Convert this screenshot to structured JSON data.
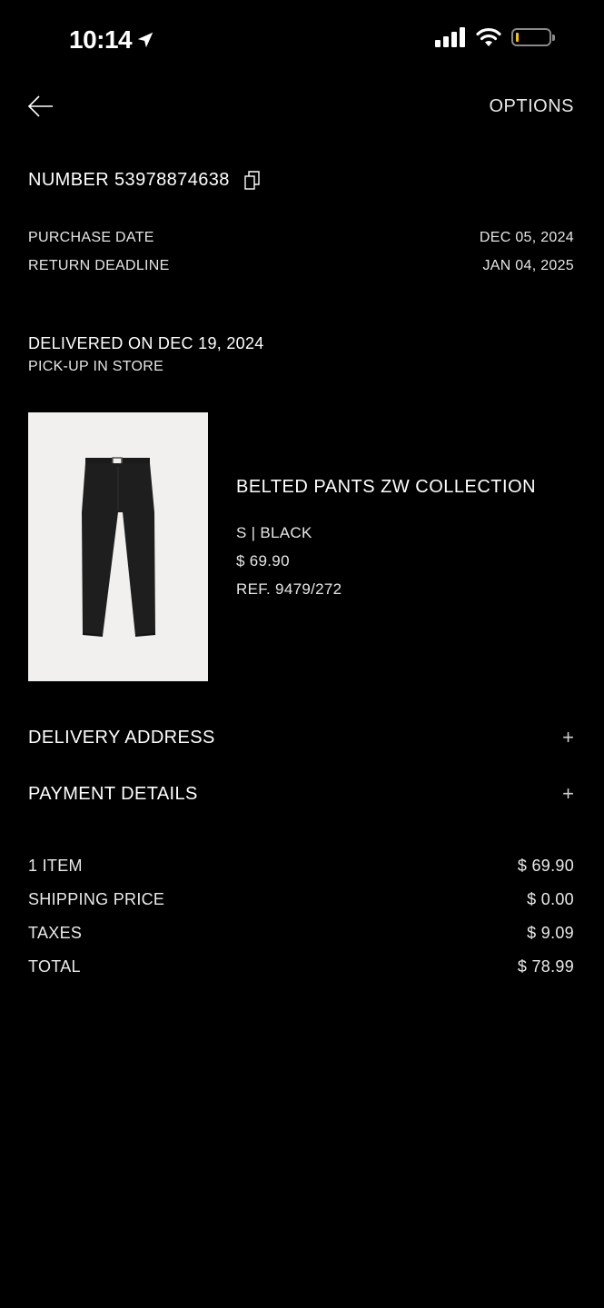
{
  "status_bar": {
    "time": "10:14",
    "icons": [
      "location-arrow-icon",
      "cellular-signal-icon",
      "wifi-icon",
      "battery-icon"
    ],
    "battery_color": "#f5c400"
  },
  "header": {
    "back_icon": "arrow-left-icon",
    "options_label": "OPTIONS"
  },
  "order": {
    "number_label": "NUMBER 53978874638",
    "copy_icon": "copy-icon",
    "purchase_date_label": "PURCHASE DATE",
    "purchase_date_value": "DEC 05, 2024",
    "return_deadline_label": "RETURN DEADLINE",
    "return_deadline_value": "JAN 04, 2025",
    "delivered_text": "DELIVERED ON DEC 19, 2024",
    "pickup_text": "PICK-UP IN STORE"
  },
  "product": {
    "name": "BELTED PANTS ZW COLLECTION",
    "variant": "S | BLACK",
    "price": "$ 69.90",
    "ref": "REF. 9479/272",
    "image_bg": "#f1f0ef"
  },
  "sections": [
    {
      "label": "DELIVERY ADDRESS",
      "icon": "plus-icon",
      "symbol": "+"
    },
    {
      "label": "PAYMENT DETAILS",
      "icon": "plus-icon",
      "symbol": "+"
    }
  ],
  "summary": [
    {
      "label": "1 ITEM",
      "value": "$ 69.90"
    },
    {
      "label": "SHIPPING PRICE",
      "value": "$ 0.00"
    },
    {
      "label": "TAXES",
      "value": "$ 9.09"
    },
    {
      "label": "TOTAL",
      "value": "$ 78.99"
    }
  ]
}
